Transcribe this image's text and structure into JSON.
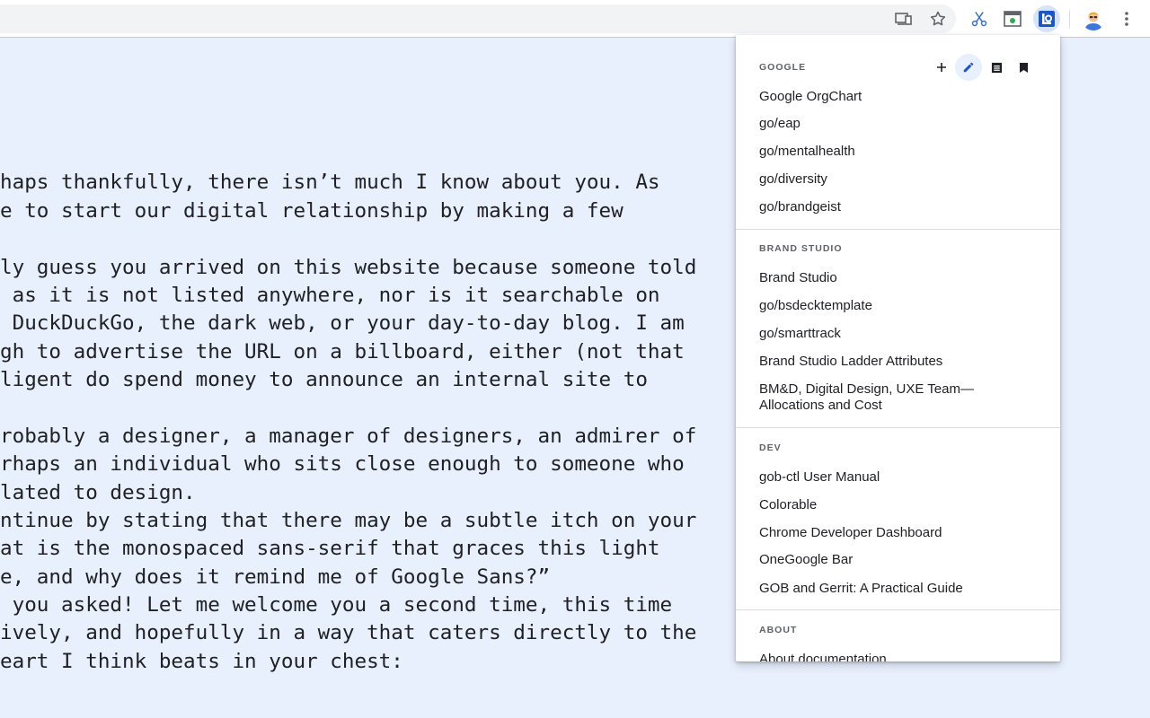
{
  "browser": {
    "icons": [
      "cast-icon",
      "star-icon",
      "scissors-icon",
      "screenshot-icon",
      "links-extension-icon",
      "avatar",
      "more-vert-icon"
    ]
  },
  "page": {
    "lines": [
      "haps thankfully, there isn’t much I know about you. As",
      "e to start our digital relationship by making a few",
      "",
      "ly guess you arrived on this website because someone told",
      " as it is not listed anywhere, nor is it searchable on",
      " DuckDuckGo, the dark web, or your day-to-day blog. I am",
      "gh to advertise the URL on a billboard, either (not that",
      "ligent do spend money to announce an internal site to",
      "",
      "robably a designer, a manager of designers, an admirer of",
      "rhaps an individual who sits close enough to someone who",
      "lated to design.",
      "ntinue by stating that there may be a subtle itch on your",
      "at is the monospaced sans-serif that graces this light",
      "e, and why does it remind me of Google Sans?”",
      " you asked! Let me welcome you a second time, this time",
      "ively, and hopefully in a way that caters directly to the",
      "eart I think beats in your chest:"
    ]
  },
  "popup": {
    "sections": [
      {
        "title": "GOOGLE",
        "links": [
          "Google OrgChart",
          "go/eap",
          "go/mentalhealth",
          "go/diversity",
          "go/brandgeist"
        ]
      },
      {
        "title": "BRAND STUDIO",
        "links": [
          "Brand Studio",
          "go/bsdecktemplate",
          "go/smarttrack",
          "Brand Studio Ladder Attributes",
          "BM&D, Digital Design, UXE Team—\nAllocations and Cost"
        ]
      },
      {
        "title": "DEV",
        "links": [
          "gob-ctl User Manual",
          "Colorable",
          "Chrome Developer Dashboard",
          "OneGoogle Bar",
          "GOB and Gerrit: A Practical Guide"
        ]
      },
      {
        "title": "ABOUT",
        "links": [
          "About documentation"
        ]
      }
    ],
    "actions": [
      "add-icon",
      "edit-icon",
      "list-icon",
      "bookmark-icon"
    ]
  }
}
